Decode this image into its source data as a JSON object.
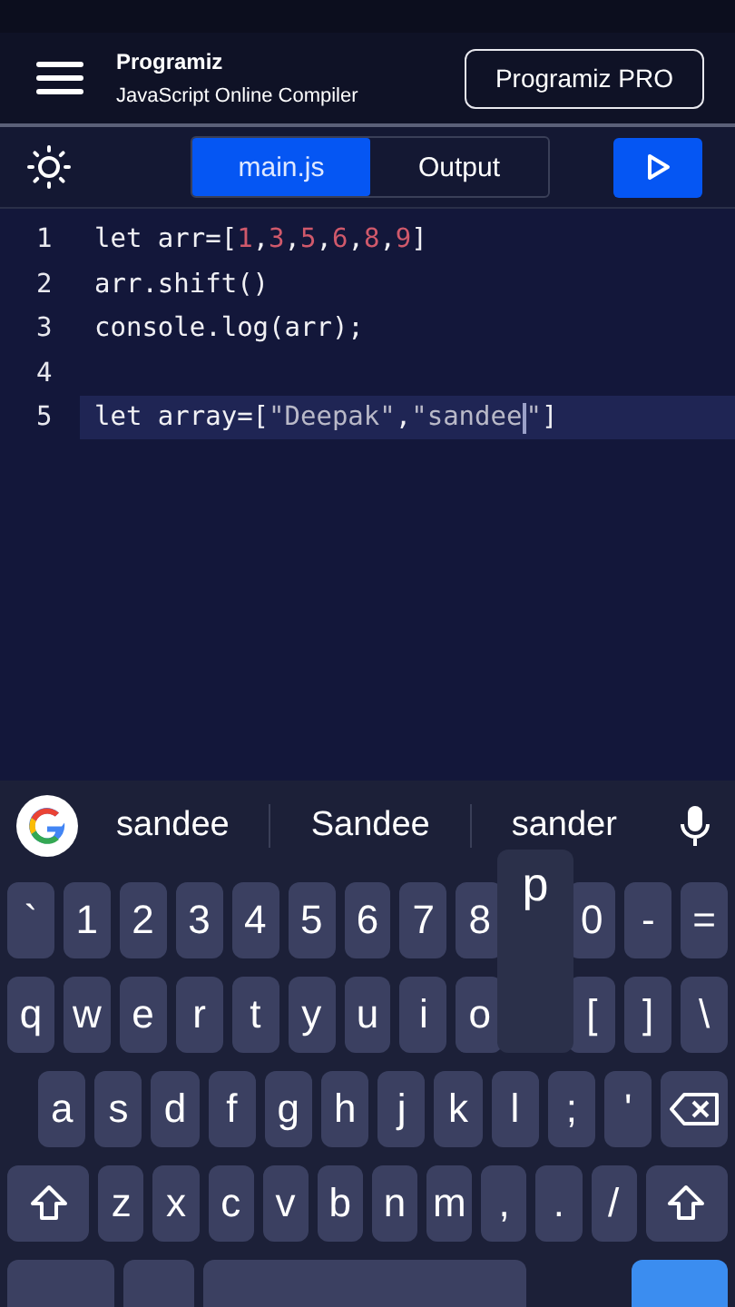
{
  "header": {
    "logo": "Programiz",
    "subtitle": "JavaScript Online Compiler",
    "pro_button": "Programiz PRO"
  },
  "tabs": [
    {
      "label": "main.js",
      "selected": true
    },
    {
      "label": "Output",
      "selected": false
    }
  ],
  "editor": {
    "lines": [
      {
        "number": "1",
        "current": false,
        "tokens": [
          {
            "kind": "plain",
            "text": "let arr=["
          },
          {
            "kind": "number",
            "text": "1"
          },
          {
            "kind": "plain",
            "text": ","
          },
          {
            "kind": "number",
            "text": "3"
          },
          {
            "kind": "plain",
            "text": ","
          },
          {
            "kind": "number",
            "text": "5"
          },
          {
            "kind": "plain",
            "text": ","
          },
          {
            "kind": "number",
            "text": "6"
          },
          {
            "kind": "plain",
            "text": ","
          },
          {
            "kind": "number",
            "text": "8"
          },
          {
            "kind": "plain",
            "text": ","
          },
          {
            "kind": "number",
            "text": "9"
          },
          {
            "kind": "plain",
            "text": "]"
          }
        ]
      },
      {
        "number": "2",
        "current": false,
        "tokens": [
          {
            "kind": "plain",
            "text": "arr.shift()"
          }
        ]
      },
      {
        "number": "3",
        "current": false,
        "tokens": [
          {
            "kind": "plain",
            "text": "console.log(arr);"
          }
        ]
      },
      {
        "number": "4",
        "current": false
      },
      {
        "number": "5",
        "current": true,
        "tokens": [
          {
            "kind": "plain",
            "text": "let array=["
          },
          {
            "kind": "string",
            "text": "\"Deepak\""
          },
          {
            "kind": "plain",
            "text": ","
          },
          {
            "kind": "string",
            "text": "\"sandee"
          },
          {
            "kind": "cursor"
          },
          {
            "kind": "string",
            "text": "\""
          },
          {
            "kind": "plain",
            "text": "]"
          }
        ]
      }
    ]
  },
  "keyboard": {
    "suggestions": [
      "sandee",
      "Sandee",
      "sander"
    ],
    "popup": "p",
    "rows": [
      {
        "keys": [
          {
            "kind": "char",
            "label": "`"
          },
          {
            "kind": "char",
            "label": "1"
          },
          {
            "kind": "char",
            "label": "2"
          },
          {
            "kind": "char",
            "label": "3"
          },
          {
            "kind": "char",
            "label": "4"
          },
          {
            "kind": "char",
            "label": "5"
          },
          {
            "kind": "char",
            "label": "6"
          },
          {
            "kind": "char",
            "label": "7"
          },
          {
            "kind": "char",
            "label": "8"
          },
          {
            "kind": "gap"
          },
          {
            "kind": "char",
            "label": "0"
          },
          {
            "kind": "char",
            "label": "-"
          },
          {
            "kind": "char",
            "label": "="
          }
        ]
      },
      {
        "keys": [
          {
            "kind": "char",
            "label": "q"
          },
          {
            "kind": "char",
            "label": "w"
          },
          {
            "kind": "char",
            "label": "e"
          },
          {
            "kind": "char",
            "label": "r"
          },
          {
            "kind": "char",
            "label": "t"
          },
          {
            "kind": "char",
            "label": "y"
          },
          {
            "kind": "char",
            "label": "u"
          },
          {
            "kind": "char",
            "label": "i"
          },
          {
            "kind": "char",
            "label": "o"
          },
          {
            "kind": "gap"
          },
          {
            "kind": "char",
            "label": "["
          },
          {
            "kind": "char",
            "label": "]"
          },
          {
            "kind": "char",
            "label": "\\"
          }
        ]
      },
      {
        "keys": [
          {
            "kind": "char",
            "label": "a"
          },
          {
            "kind": "char",
            "label": "s"
          },
          {
            "kind": "char",
            "label": "d"
          },
          {
            "kind": "char",
            "label": "f"
          },
          {
            "kind": "char",
            "label": "g"
          },
          {
            "kind": "char",
            "label": "h"
          },
          {
            "kind": "char",
            "label": "j"
          },
          {
            "kind": "char",
            "label": "k"
          },
          {
            "kind": "char",
            "label": "l"
          },
          {
            "kind": "char",
            "label": ";"
          },
          {
            "kind": "char",
            "label": "'"
          },
          {
            "kind": "backspace"
          }
        ]
      },
      {
        "keys": [
          {
            "kind": "shift"
          },
          {
            "kind": "char",
            "label": "z"
          },
          {
            "kind": "char",
            "label": "x"
          },
          {
            "kind": "char",
            "label": "c"
          },
          {
            "kind": "char",
            "label": "v"
          },
          {
            "kind": "char",
            "label": "b"
          },
          {
            "kind": "char",
            "label": "n"
          },
          {
            "kind": "char",
            "label": "m"
          },
          {
            "kind": "char",
            "label": ","
          },
          {
            "kind": "char",
            "label": "."
          },
          {
            "kind": "char",
            "label": "/"
          },
          {
            "kind": "shift"
          }
        ]
      },
      {
        "keys": [
          {
            "kind": "wide"
          },
          {
            "kind": "mod"
          },
          {
            "kind": "space"
          },
          {
            "kind": "blank"
          },
          {
            "kind": "enter"
          }
        ]
      }
    ]
  }
}
